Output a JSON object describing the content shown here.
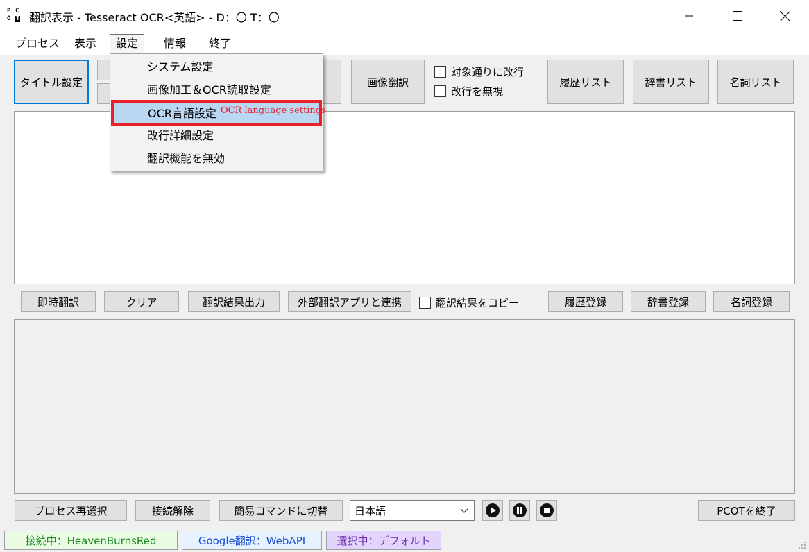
{
  "window": {
    "title": "翻訳表示 - Tesseract OCR<英語> - D：〇 T：〇",
    "icon_letters": [
      "P",
      "C",
      "O",
      "T"
    ],
    "controls": [
      "minimize-icon",
      "maximize-icon",
      "close-icon"
    ]
  },
  "menubar": {
    "items": [
      "プロセス",
      "表示",
      "設定",
      "情報",
      "終了"
    ],
    "active": "設定"
  },
  "settings_menu": {
    "items": [
      "システム設定",
      "画像加工＆OCR読取設定",
      "OCR言語設定",
      "改行詳細設定",
      "翻訳機能を無効"
    ],
    "highlighted": "OCR言語設定",
    "annotation": "OCR language settings",
    "annotation_color": "#e8202a"
  },
  "toolbar": {
    "title_settings": "タイトル設定",
    "image_translate": "画像翻訳",
    "chk_line_break": "対象通りに改行",
    "chk_ignore_break": "改行を無視",
    "history_list": "履歴リスト",
    "dict_list": "辞書リスト",
    "noun_list": "名詞リスト"
  },
  "actions": {
    "instant_translate": "即時翻訳",
    "clear": "クリア",
    "output_result": "翻訳結果出力",
    "external_app": "外部翻訳アプリと連携",
    "chk_copy_result": "翻訳結果をコピー",
    "history_register": "履歴登録",
    "dict_register": "辞書登録",
    "noun_register": "名詞登録"
  },
  "bottom": {
    "reselect_process": "プロセス再選択",
    "disconnect": "接続解除",
    "simple_command": "簡易コマンドに切替",
    "language_selected": "日本語",
    "quit": "PCOTを終了",
    "media_icons": [
      "play-icon",
      "pause-icon",
      "stop-icon"
    ]
  },
  "status": {
    "connection": "接続中：HeavenBurnsRed",
    "translator": "Google翻訳：WebAPI",
    "selection": "選択中：デフォルト",
    "colors": {
      "connection_bg": "#eafbe4",
      "connection_fg": "#1f8a1f",
      "translator_bg": "#e6f2ff",
      "translator_fg": "#1a4fd0",
      "selection_bg": "#e3d4fb",
      "selection_fg": "#6a2fb0"
    }
  }
}
